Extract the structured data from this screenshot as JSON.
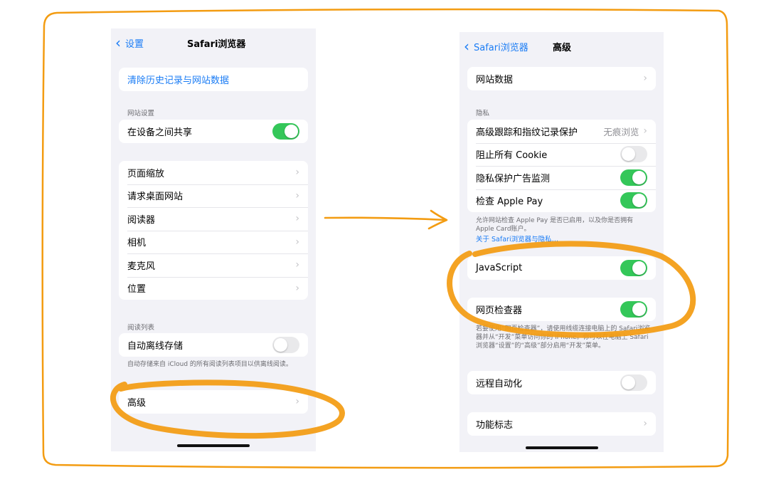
{
  "left_screen": {
    "nav": {
      "back_label": "设置",
      "title": "Safari浏览器"
    },
    "clear_history": "清除历史记录与网站数据",
    "website_settings_header": "网站设置",
    "share_across_devices": {
      "label": "在设备之间共享",
      "on": true
    },
    "site_items": [
      "页面缩放",
      "请求桌面网站",
      "阅读器",
      "相机",
      "麦克风",
      "位置"
    ],
    "reading_list_header": "阅读列表",
    "offline_storage": {
      "label": "自动离线存储",
      "on": false
    },
    "offline_storage_footer": "自动存储来自 iCloud 的所有阅读列表项目以供离线阅读。",
    "advanced": "高级"
  },
  "right_screen": {
    "nav": {
      "back_label": "Safari浏览器",
      "title": "高级"
    },
    "website_data": "网站数据",
    "privacy_header": "隐私",
    "privacy_rows": [
      {
        "label": "高级跟踪和指纹记录保护",
        "value": "无痕浏览"
      },
      {
        "label": "阻止所有 Cookie",
        "on": false
      },
      {
        "label": "隐私保护广告监测",
        "on": true
      },
      {
        "label": "检查 Apple Pay",
        "on": true
      }
    ],
    "apple_pay_footer": "允许网站检查 Apple Pay 是否已启用，以及你是否拥有 Apple Card账户。",
    "privacy_link": "关于 Safari浏览器与隐私…",
    "javascript": {
      "label": "JavaScript",
      "on": true
    },
    "web_inspector": {
      "label": "网页检查器",
      "on": true
    },
    "web_inspector_footer": "若要使用“网页检查器”，请使用线缆连接电脑上的 Safari浏览器并从“开发”菜单访问你的 iPhone。你可以在电脑上 Safari浏览器“设置”的“高级”部分启用“开发”菜单。",
    "remote_automation": {
      "label": "远程自动化",
      "on": false
    },
    "feature_flags": "功能标志"
  },
  "colors": {
    "ios_blue": "#1a7cf5",
    "toggle_green": "#34c759",
    "annotation_orange": "#f39c12",
    "background_gray": "#f2f2f7"
  }
}
